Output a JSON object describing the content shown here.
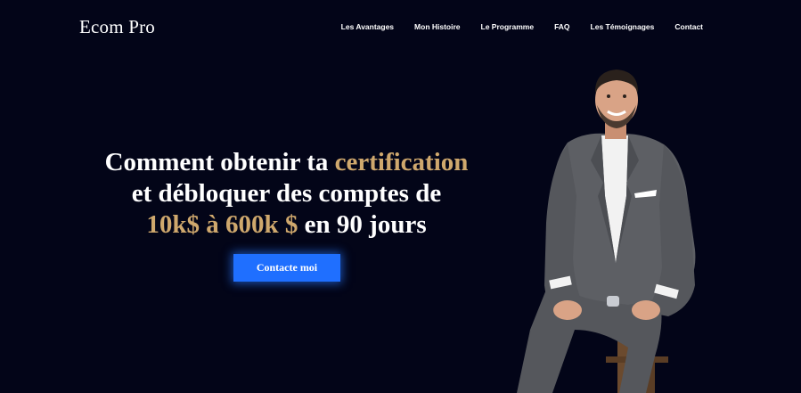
{
  "header": {
    "logo": "Ecom Pro",
    "nav": [
      {
        "label": "Les Avantages"
      },
      {
        "label": "Mon Histoire"
      },
      {
        "label": "Le Programme"
      },
      {
        "label": "FAQ"
      },
      {
        "label": "Les Témoignages"
      },
      {
        "label": "Contact"
      }
    ]
  },
  "hero": {
    "line1_a": "Comment obtenir ta ",
    "line1_b": "certification",
    "line2": "et débloquer des comptes de",
    "line3_a": "10k$ à 600k $",
    "line3_b": " en 90 jours",
    "cta_label": "Contacte moi"
  },
  "colors": {
    "background": "#030518",
    "accent_gold": "#cfa86d",
    "cta_blue": "#1f6fff"
  }
}
